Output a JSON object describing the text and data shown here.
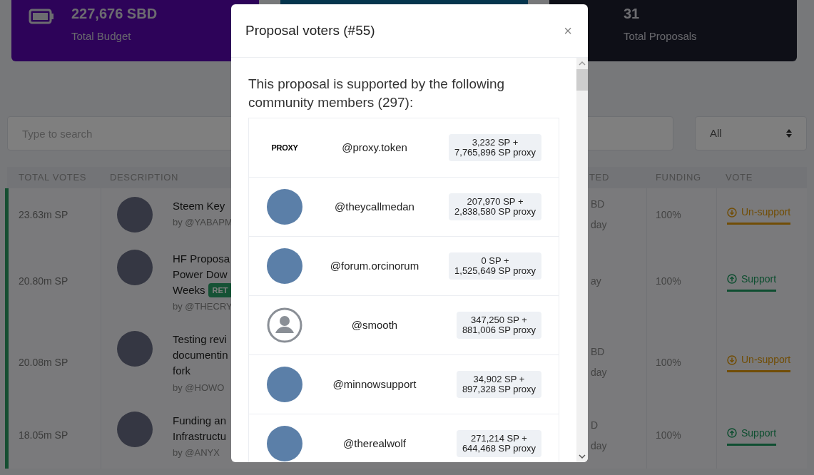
{
  "stat_cards": [
    {
      "kind": "budget",
      "value": "227,676 SBD",
      "label": "Total Budget"
    },
    {
      "kind": "blank"
    },
    {
      "kind": "proposals",
      "value": "31",
      "label": "Total Proposals"
    }
  ],
  "search": {
    "placeholder": "Type to search"
  },
  "filter": {
    "value": "All"
  },
  "table": {
    "columns": [
      "TOTAL VOTES",
      "DESCRIPTION",
      "TED",
      "FUNDING",
      "VOTE"
    ],
    "rows": [
      {
        "total_votes": "23.63m SP",
        "title_lines": [
          "Steem Key"
        ],
        "author": "by @YABAPM",
        "column_3": [
          "BD",
          "day"
        ],
        "funding": "100%",
        "vote": {
          "kind": "unsupport",
          "label": "Un-support"
        }
      },
      {
        "total_votes": "20.80m SP",
        "title_lines": [
          "HF Proposa",
          "Power Dow",
          "Weeks"
        ],
        "badge": "RET",
        "author": "by @THECRY",
        "column_3": [
          "ay"
        ],
        "funding": "100%",
        "vote": {
          "kind": "support",
          "label": "Support"
        }
      },
      {
        "total_votes": "20.08m SP",
        "title_lines": [
          "Testing revi",
          "documentin",
          "fork"
        ],
        "author": "by @HOWO",
        "column_3": [
          "BD",
          "day"
        ],
        "funding": "100%",
        "vote": {
          "kind": "unsupport",
          "label": "Un-support"
        }
      },
      {
        "total_votes": "18.05m SP",
        "title_lines": [
          "Funding an",
          "Infrastructu"
        ],
        "author": "by @ANYX",
        "column_3": [
          "D",
          "day"
        ],
        "funding": "100%",
        "vote": {
          "kind": "support",
          "label": "Support"
        }
      }
    ]
  },
  "modal": {
    "title": "Proposal voters (#55)",
    "close": "×",
    "intro": "This proposal is supported by the following community members (297):",
    "voters": [
      {
        "avatar": {
          "kind": "logo",
          "text": "PROXY"
        },
        "name": "@proxy.token",
        "own": "3,232 SP +",
        "proxy": "7,765,896 SP proxy"
      },
      {
        "avatar": {
          "kind": "photo"
        },
        "name": "@theycallmedan",
        "own": "207,970 SP +",
        "proxy": "2,838,580 SP proxy"
      },
      {
        "avatar": {
          "kind": "photo"
        },
        "name": "@forum.orcinorum",
        "own": "0 SP +",
        "proxy": "1,525,649 SP proxy"
      },
      {
        "avatar": {
          "kind": "default"
        },
        "name": "@smooth",
        "own": "347,250 SP +",
        "proxy": "881,006 SP proxy"
      },
      {
        "avatar": {
          "kind": "photo"
        },
        "name": "@minnowsupport",
        "own": "34,902 SP +",
        "proxy": "897,328 SP proxy"
      },
      {
        "avatar": {
          "kind": "photo"
        },
        "name": "@therealwolf",
        "own": "271,214 SP +",
        "proxy": "644,468 SP proxy"
      }
    ]
  }
}
